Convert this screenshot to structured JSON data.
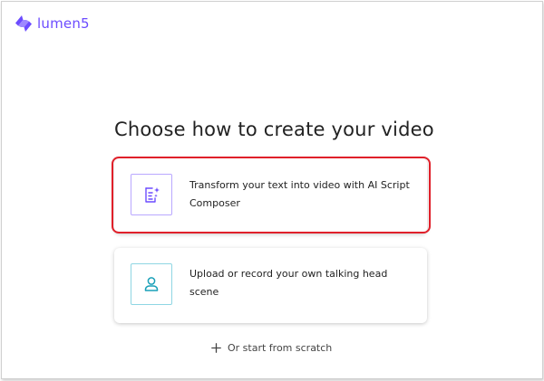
{
  "brand": {
    "name": "lumen5",
    "logo_icon": "lumen5-logo-icon",
    "accent": "#6c4cff"
  },
  "page": {
    "title": "Choose how to create your video"
  },
  "options": [
    {
      "label": "Transform your text into video with AI Script Composer",
      "icon": "script-sparkle-icon",
      "highlighted": true,
      "highlight_color": "#e0202a"
    },
    {
      "label": "Upload or record your own talking head scene",
      "icon": "person-icon",
      "highlighted": false
    }
  ],
  "scratch": {
    "label": "Or start from scratch",
    "icon": "plus-icon"
  }
}
